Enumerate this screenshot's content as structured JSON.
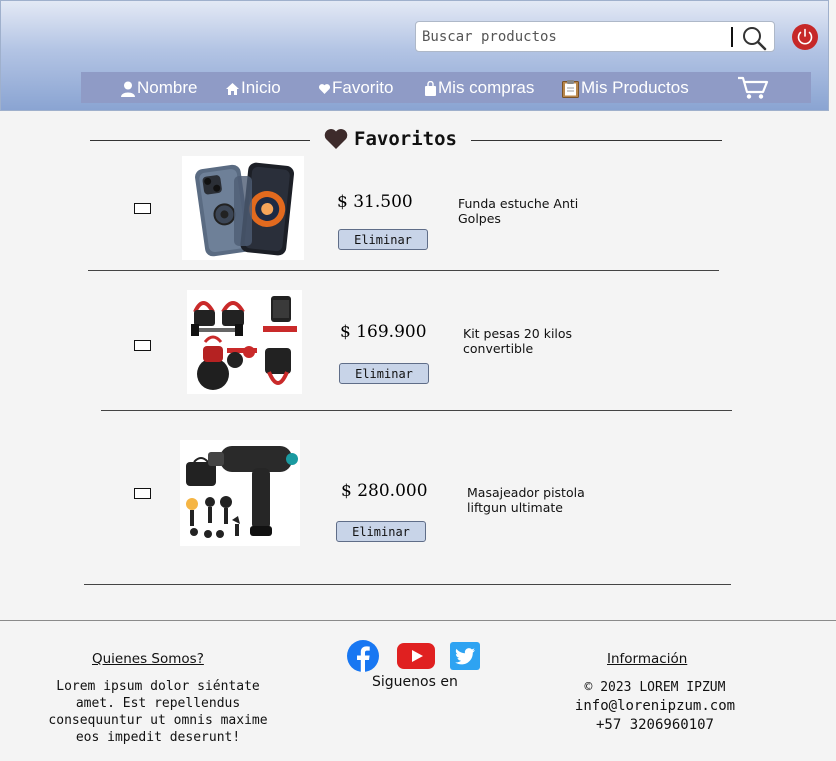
{
  "header": {
    "search": {
      "placeholder": "Buscar productos",
      "value": ""
    },
    "nav": [
      {
        "label": "Nombre",
        "icon": "user-icon"
      },
      {
        "label": "Inicio",
        "icon": "home-icon"
      },
      {
        "label": "Favorito",
        "icon": "heart-icon"
      },
      {
        "label": "Mis compras",
        "icon": "shopping-bag-icon"
      },
      {
        "label": "Mis Productos",
        "icon": "clipboard-icon"
      }
    ],
    "cart_icon": "cart-icon",
    "power_icon": "power-icon",
    "colors": {
      "power": "#c62828",
      "nav_bg": "#8f9bc6"
    }
  },
  "favorites": {
    "title": "Favoritos",
    "remove_label": "Eliminar",
    "items": [
      {
        "price": "$ 31.500",
        "name": "Funda estuche Anti Golpes",
        "image": "phone-case-image"
      },
      {
        "price": "$ 169.900",
        "name": "Kit pesas 20 kilos convertible",
        "image": "kettlebell-dumbbell-kit-image"
      },
      {
        "price": "$ 280.000",
        "name": "Masajeador pistola liftgun ultimate",
        "image": "massage-gun-image"
      }
    ]
  },
  "footer": {
    "about": {
      "heading": "Quienes Somos?",
      "text": "Lorem ipsum dolor siéntate amet. Est repellendus consequuntur ut omnis maxime eos impedit deserunt!"
    },
    "social": {
      "label": "Siguenos en",
      "icons": [
        "facebook-icon",
        "youtube-icon",
        "twitter-icon"
      ]
    },
    "info": {
      "heading": "Información",
      "copyright": "© 2023 LOREM IPZUM",
      "email": "info@lorenipzum.com",
      "phone": "+57 3206960107"
    }
  }
}
